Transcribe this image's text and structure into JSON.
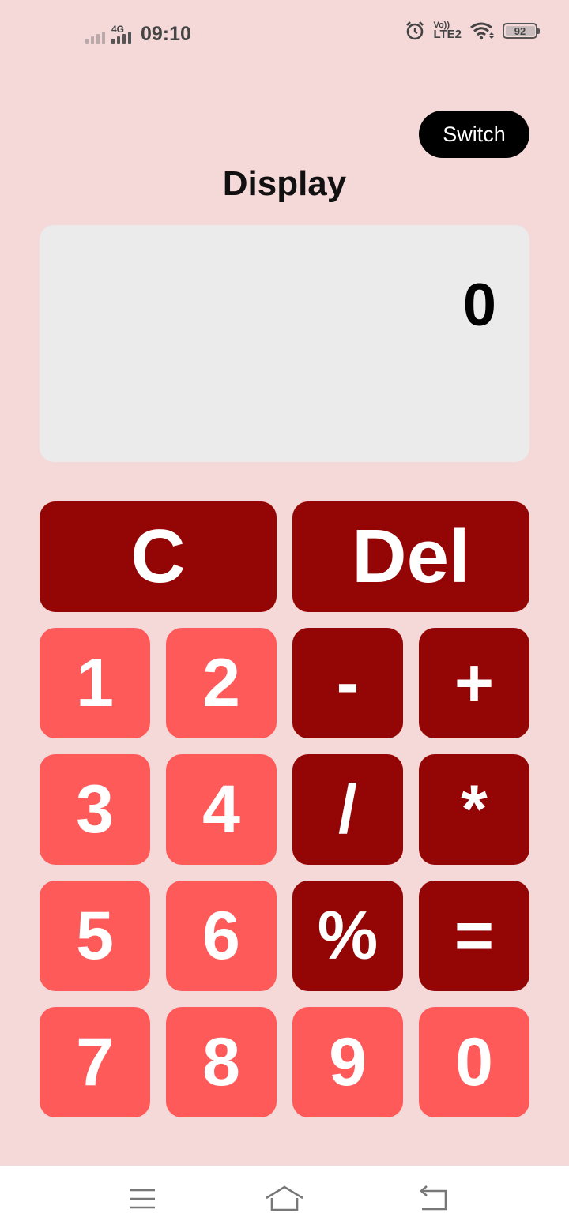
{
  "status_bar": {
    "network_type": "4G",
    "time": "09:10",
    "volte_label": "Vo))",
    "lte_label": "LTE2",
    "battery_level": "92",
    "icons": [
      "signal-weak-icon",
      "signal-4g-icon",
      "alarm-icon",
      "volte-icon",
      "wifi-icon",
      "battery-icon"
    ]
  },
  "header": {
    "switch_label": "Switch",
    "display_title": "Display"
  },
  "display": {
    "value": "0"
  },
  "keys": {
    "clear": "C",
    "delete": "Del",
    "one": "1",
    "two": "2",
    "minus": "-",
    "plus": "+",
    "three": "3",
    "four": "4",
    "divide": "/",
    "multiply": "*",
    "five": "5",
    "six": "6",
    "percent": "%",
    "equals": "=",
    "seven": "7",
    "eight": "8",
    "nine": "9",
    "zero": "0"
  },
  "colors": {
    "background": "#f5d8d8",
    "operator_key": "#940606",
    "digit_key": "#ff5a5a",
    "display_box": "#ebebeb"
  },
  "nav_bar": {
    "icons": [
      "menu-icon",
      "home-icon",
      "back-icon"
    ]
  }
}
